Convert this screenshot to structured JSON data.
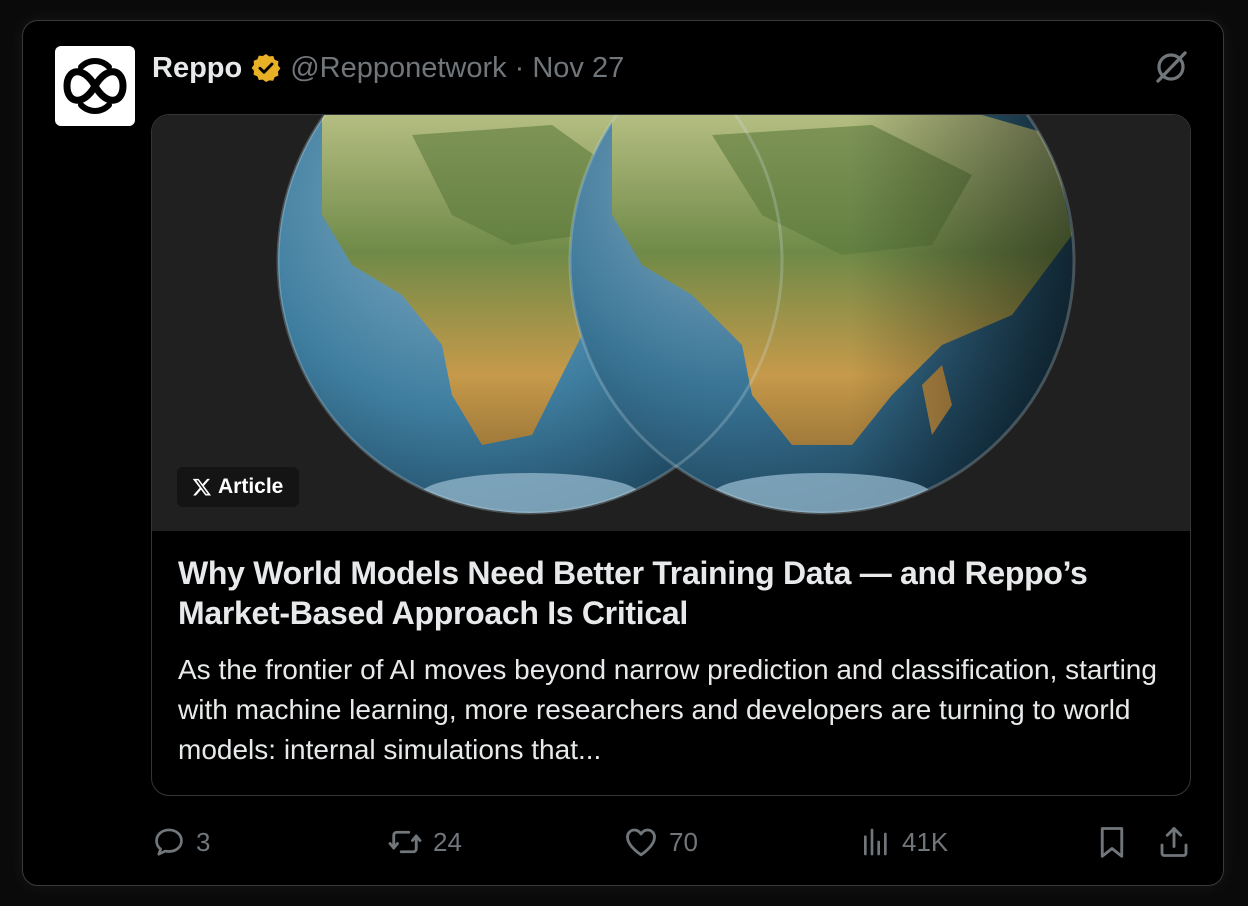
{
  "post": {
    "author_name": "Reppo",
    "handle": "@Repponetwork",
    "separator": "·",
    "date": "Nov 27"
  },
  "article": {
    "badge_label": "Article",
    "title": "Why World Models Need Better Training Data — and Reppo’s Market-Based Approach Is Critical",
    "description": "As the frontier of AI moves beyond narrow prediction and classification, starting with machine learning, more researchers and developers are turning to world models: internal simulations that..."
  },
  "actions": {
    "replies": "3",
    "reposts": "24",
    "likes": "70",
    "views": "41K"
  },
  "icons": {
    "verified": "verified-badge-icon",
    "grok": "grok-icon",
    "reply": "reply-icon",
    "repost": "repost-icon",
    "like": "like-icon",
    "views": "views-icon",
    "bookmark": "bookmark-icon",
    "share": "share-icon"
  },
  "colors": {
    "background": "#000000",
    "text_primary": "#e7e9ea",
    "text_secondary": "#71767b",
    "verified_gold": "#e8b025",
    "border": "#333639"
  }
}
